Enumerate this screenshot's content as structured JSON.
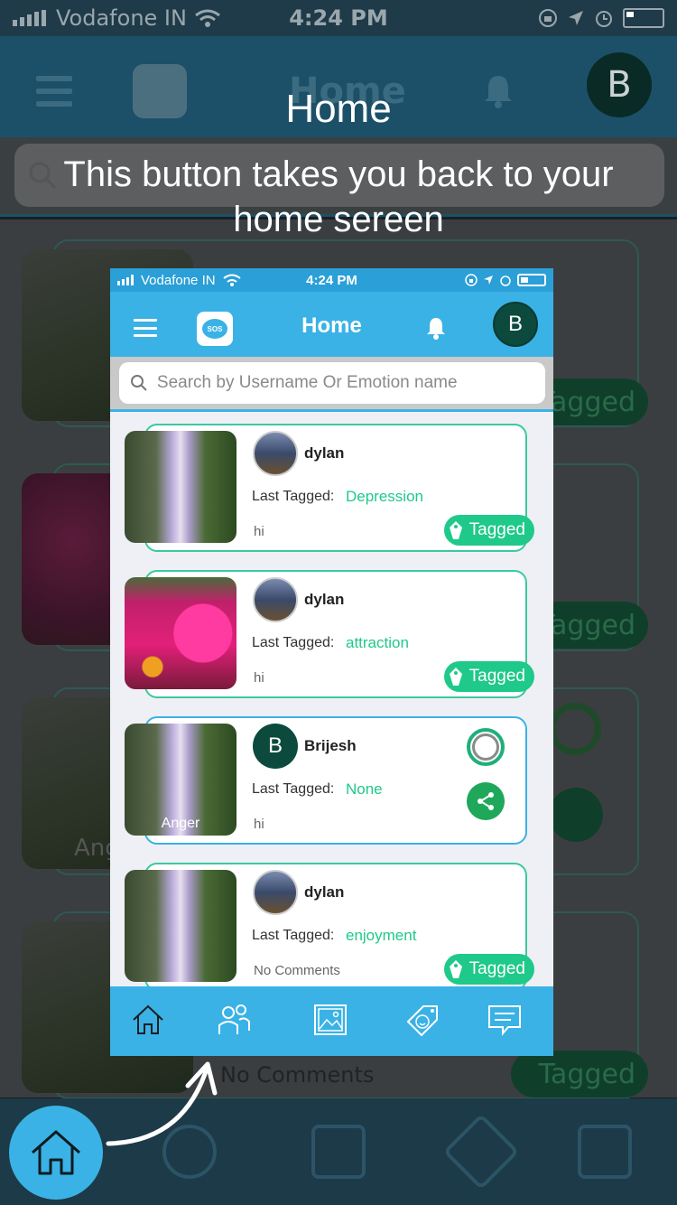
{
  "background": {
    "status": {
      "carrier": "Vodafone IN",
      "time": "4:24 PM"
    },
    "header": {
      "title": "Home",
      "avatar_letter": "B"
    },
    "tag_label": "Tagged",
    "thumb_caption": "Ang",
    "no_comments": "No Comments"
  },
  "tooltip": {
    "title": "Home",
    "text": "This button takes you back to your home sereen"
  },
  "preview": {
    "status": {
      "carrier": "Vodafone IN",
      "time": "4:24 PM"
    },
    "header": {
      "title": "Home",
      "avatar_letter": "B",
      "logo_text": "SOS"
    },
    "search": {
      "placeholder": "Search by Username Or Emotion name"
    },
    "last_tagged_label": "Last Tagged:",
    "cards": [
      {
        "name": "dylan",
        "emotion": "Depression",
        "comment": "hi",
        "tag": "Tagged",
        "thumb_caption": ""
      },
      {
        "name": "dylan",
        "emotion": "attraction",
        "comment": "hi",
        "tag": "Tagged",
        "thumb_caption": ""
      },
      {
        "name": "Brijesh",
        "avatar_letter": "B",
        "emotion": "None",
        "comment": "hi",
        "tag": "",
        "thumb_caption": "Anger"
      },
      {
        "name": "dylan",
        "emotion": "enjoyment",
        "comment": "No Comments",
        "tag": "Tagged",
        "thumb_caption": ""
      }
    ],
    "nav": [
      "home-icon",
      "users-icon",
      "gallery-icon",
      "emotion-tag-icon",
      "chat-icon"
    ]
  },
  "colors": {
    "accent": "#3ab2e6",
    "tag_green": "#1fc98a",
    "avatar_dark": "#0b4a3c",
    "card_border": "#3cc9a0"
  }
}
